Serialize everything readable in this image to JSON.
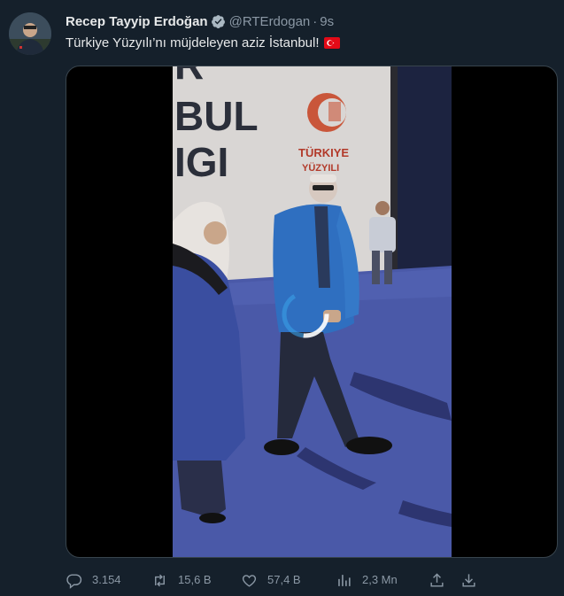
{
  "author": {
    "name": "Recep Tayyip Erdoğan",
    "handle": "@RTErdogan",
    "time": "9s"
  },
  "separator": "·",
  "tweet": {
    "text": "Türkiye Yüzyılı’nı müjdeleyen aziz İstanbul!",
    "flag_icon": "turkey-flag-icon"
  },
  "video": {
    "billboard_lines": [
      "R",
      "BUL",
      "IGI"
    ],
    "logo_text": "TÜRKIYE",
    "logo_text2": "YÜZYILI"
  },
  "actions": {
    "replies": "3.154",
    "retweets": "15,6 B",
    "likes": "57,4 B",
    "views": "2,3 Mn"
  },
  "colors": {
    "background": "#15202b",
    "secondary_text": "#8b98a5",
    "verified": "#aab8c2",
    "video_floor": "#4a59a8",
    "jacket": "#2f6fc0"
  }
}
